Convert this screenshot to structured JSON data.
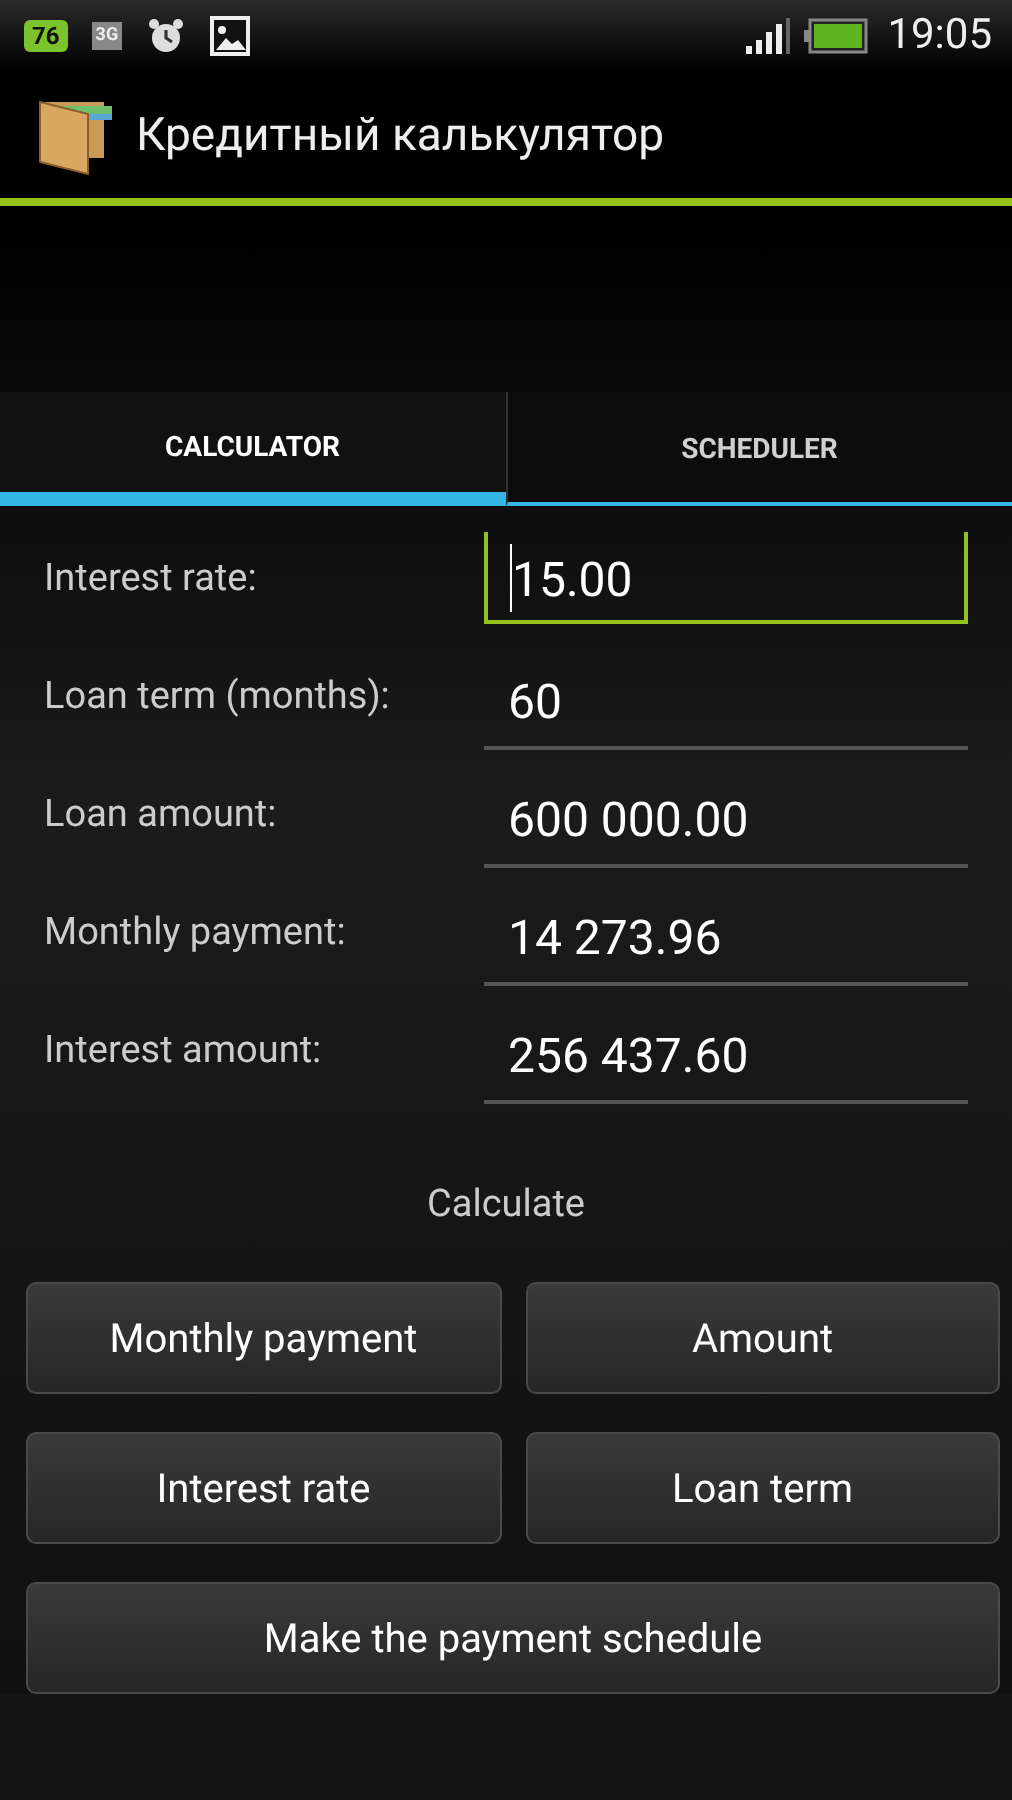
{
  "status_bar": {
    "badge": "76",
    "network": "3G",
    "time": "19:05"
  },
  "app_bar": {
    "title": "Кредитный калькулятор"
  },
  "tabs": [
    {
      "label": "CALCULATOR",
      "selected": true
    },
    {
      "label": "SCHEDULER",
      "selected": false
    }
  ],
  "fields": [
    {
      "label": "Interest rate:",
      "value": "15.00",
      "focused": true
    },
    {
      "label": "Loan term (months):",
      "value": "60",
      "focused": false
    },
    {
      "label": "Loan amount:",
      "value": "600 000.00",
      "focused": false
    },
    {
      "label": "Monthly payment:",
      "value": "14 273.96",
      "focused": false
    },
    {
      "label": "Interest amount:",
      "value": "256 437.60",
      "focused": false
    }
  ],
  "calculate_heading": "Calculate",
  "buttons": [
    "Monthly payment",
    "Amount",
    "Interest rate",
    "Loan term",
    "Make the payment schedule"
  ]
}
